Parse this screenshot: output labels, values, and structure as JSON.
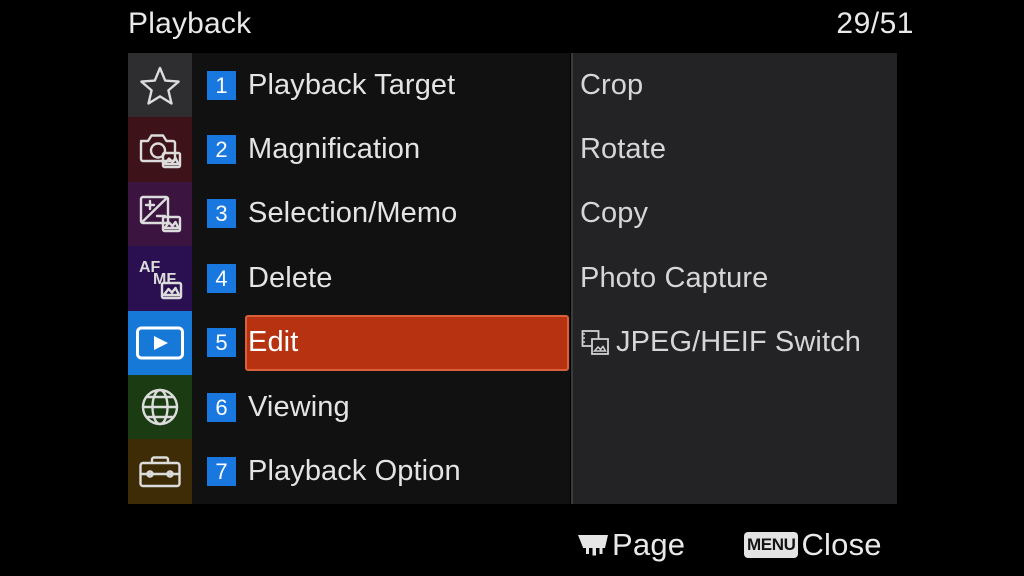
{
  "header": {
    "title": "Playback",
    "counter": "29/51"
  },
  "sidebar": {
    "tabs": [
      {
        "icon": "star-icon",
        "name": "my-menu",
        "bg": "#2e2e30",
        "active": false
      },
      {
        "icon": "camera-photo-icon",
        "name": "shooting",
        "bg": "#3d1218",
        "active": false
      },
      {
        "icon": "exposure-icon",
        "name": "exposure",
        "bg": "#3b1540",
        "active": false
      },
      {
        "icon": "afmf-icon",
        "name": "focus",
        "bg": "#2a1050",
        "active": false
      },
      {
        "icon": "playback-icon",
        "name": "playback",
        "bg": "#1679d8",
        "active": true
      },
      {
        "icon": "globe-icon",
        "name": "network",
        "bg": "#1b3c13",
        "active": false
      },
      {
        "icon": "toolbox-icon",
        "name": "setup",
        "bg": "#3d2c06",
        "active": false
      }
    ]
  },
  "menu": {
    "items": [
      {
        "number": "1",
        "label": "Playback Target",
        "selected": false
      },
      {
        "number": "2",
        "label": "Magnification",
        "selected": false
      },
      {
        "number": "3",
        "label": "Selection/Memo",
        "selected": false
      },
      {
        "number": "4",
        "label": "Delete",
        "selected": false
      },
      {
        "number": "5",
        "label": "Edit",
        "selected": true
      },
      {
        "number": "6",
        "label": "Viewing",
        "selected": false
      },
      {
        "number": "7",
        "label": "Playback Option",
        "selected": false
      }
    ]
  },
  "detail": {
    "items": [
      {
        "label": "Crop",
        "icon": null
      },
      {
        "label": "Rotate",
        "icon": null
      },
      {
        "label": "Copy",
        "icon": null
      },
      {
        "label": "Photo Capture",
        "icon": null
      },
      {
        "label": "JPEG/HEIF Switch",
        "icon": "jpeg-heif-switch-icon"
      }
    ]
  },
  "footer": {
    "page_hint": "Page",
    "close_badge": "MENU",
    "close_hint": "Close"
  },
  "colors": {
    "accent_selection": "#b63210",
    "selection_border": "#d9603a",
    "badge_blue": "#1878e0",
    "active_tab_blue": "#1679d8",
    "detail_panel_bg": "#232325",
    "menu_col_bg": "#111112",
    "text_primary": "#e9e9e9"
  }
}
